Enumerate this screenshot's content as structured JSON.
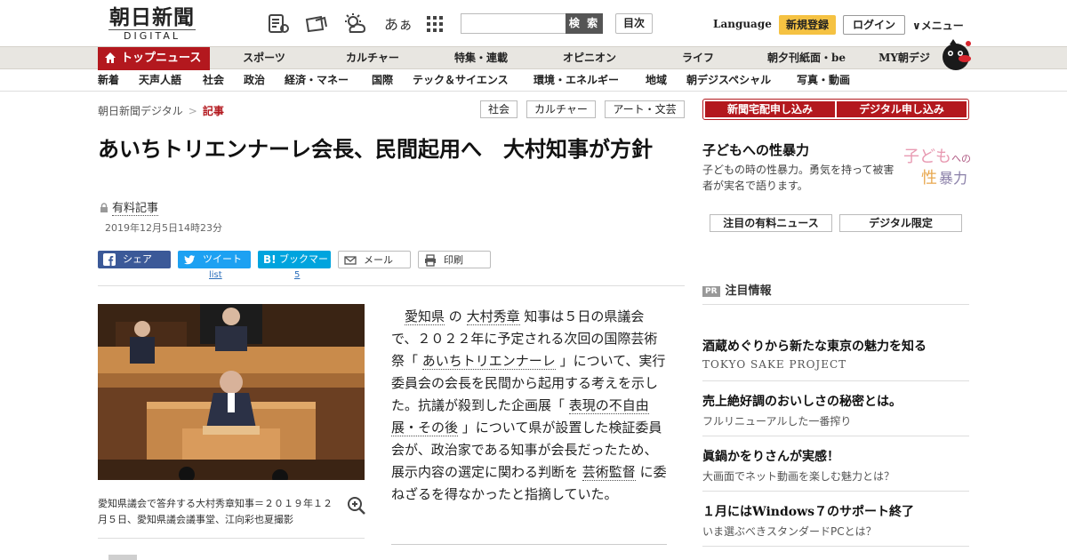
{
  "header": {
    "logo_main": "朝日新聞",
    "logo_sub": "DIGITAL",
    "font_size_icon": "あぁ",
    "search_placeholder": "",
    "search_button": "検 索",
    "toc_button": "目次",
    "language": "Language",
    "register_button": "新規登録",
    "login_button": "ログイン",
    "menu_button": "∨メニュー"
  },
  "nav_primary": {
    "top_news": "トップニュース",
    "items": [
      "スポーツ",
      "カルチャー",
      "特集・連載",
      "オピニオン",
      "ライフ",
      "朝夕刊紙面・be",
      "MY朝デジ"
    ]
  },
  "nav_secondary": {
    "items": [
      "新着",
      "天声人語",
      "社会",
      "政治",
      "経済・マネー",
      "国際",
      "テック＆サイエンス",
      "環境・エネルギー",
      "地域",
      "朝デジスペシャル",
      "写真・動画"
    ]
  },
  "breadcrumb": {
    "home": "朝日新聞デジタル",
    "separator": ">",
    "current": "記事"
  },
  "tags": [
    "社会",
    "カルチャー",
    "アート・文芸"
  ],
  "article": {
    "title": "あいちトリエンナーレ会長、民間起用へ　大村知事が方針",
    "paid_label": "有料記事",
    "date": "2019年12月5日14時23分",
    "body_parts": {
      "p1": "愛知県",
      "p2": " の ",
      "p3": "大村秀章",
      "p4": " 知事は５日の県議会で、２０２２年に予定される次回の国際芸術祭「 ",
      "p5": "あいちトリエンナーレ",
      "p6": " 」について、実行委員会の会長を民間から起用する考えを示した。抗議が殺到した企画展「 ",
      "p7": "表現の不自由展・その後",
      "p8": " 」について県が設置した検証委員会が、政治家である知事が会長だったため、展示内容の選定に関わる判断を ",
      "p9": "芸術監督",
      "p10": " に委ねざるを得なかったと指摘していた。"
    },
    "photo_caption": "愛知県議会で答弁する大村秀章知事＝２０１９年１２月５日、愛知県議会議事堂、江向彩也夏撮影"
  },
  "share": {
    "facebook": "シェア",
    "twitter": "ツイート",
    "hatena": "ブックマーク",
    "mail": "メール",
    "print": "印刷",
    "twitter_count": "list",
    "hatena_count": "5"
  },
  "sidebar": {
    "subscribe_paper": "新聞宅配申し込み",
    "subscribe_digital": "デジタル申し込み",
    "feature_title": "子どもへの性暴力",
    "feature_desc": "子どもの時の性暴力。勇気を持って被害者が実名で語ります。",
    "feature_logo_a": "子ども",
    "feature_logo_b": "への",
    "feature_logo_c": "性",
    "feature_logo_d": "暴力",
    "paid_news_button": "注目の有料ニュース",
    "digital_only_button": "デジタル限定",
    "pr_badge": "PR",
    "pr_heading": "注目情報",
    "pr_items": [
      {
        "title": "酒蔵めぐりから新たな東京の魅力を知る",
        "sub": "TOKYO SAKE PROJECT"
      },
      {
        "title": "売上絶好調のおいしさの秘密とは。",
        "sub": "フルリニューアルした一番搾り"
      },
      {
        "title": "眞鍋かをりさんが実感！",
        "sub": "大画面でネット動画を楽しむ魅力とは？"
      },
      {
        "title": "１月にはWindows７のサポート終了",
        "sub": "いま選ぶべきスタンダードPCとは？"
      }
    ]
  },
  "colors": {
    "brand_red": "#b3181e",
    "facebook": "#3b5998",
    "twitter": "#1da1f2",
    "hatena": "#00a4de",
    "register_yellow": "#f5c242"
  }
}
